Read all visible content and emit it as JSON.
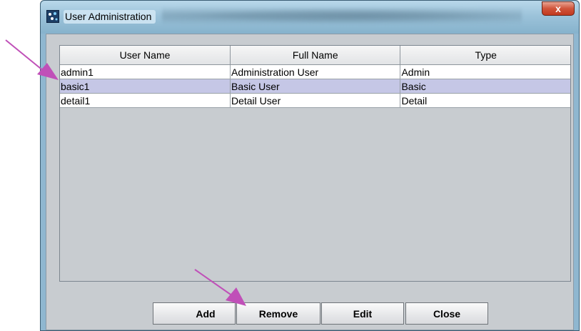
{
  "window": {
    "title": "User Administration",
    "close_glyph": "x"
  },
  "table": {
    "columns": [
      "User Name",
      "Full Name",
      "Type"
    ],
    "rows": [
      {
        "user_name": "admin1",
        "full_name": "Administration User",
        "type": "Admin",
        "selected": false
      },
      {
        "user_name": "basic1",
        "full_name": "Basic User",
        "type": "Basic",
        "selected": true
      },
      {
        "user_name": "detail1",
        "full_name": "Detail User",
        "type": "Detail",
        "selected": false
      }
    ]
  },
  "buttons": {
    "add": "Add",
    "remove": "Remove",
    "edit": "Edit",
    "close": "Close"
  },
  "annotations": {
    "arrow_color": "#c050b8",
    "targets": [
      "basic1 row",
      "Remove button"
    ]
  },
  "colors": {
    "selected_row": "#c5c7e6",
    "client_background": "#c8ccd0",
    "title_close": "#c23a1f"
  }
}
